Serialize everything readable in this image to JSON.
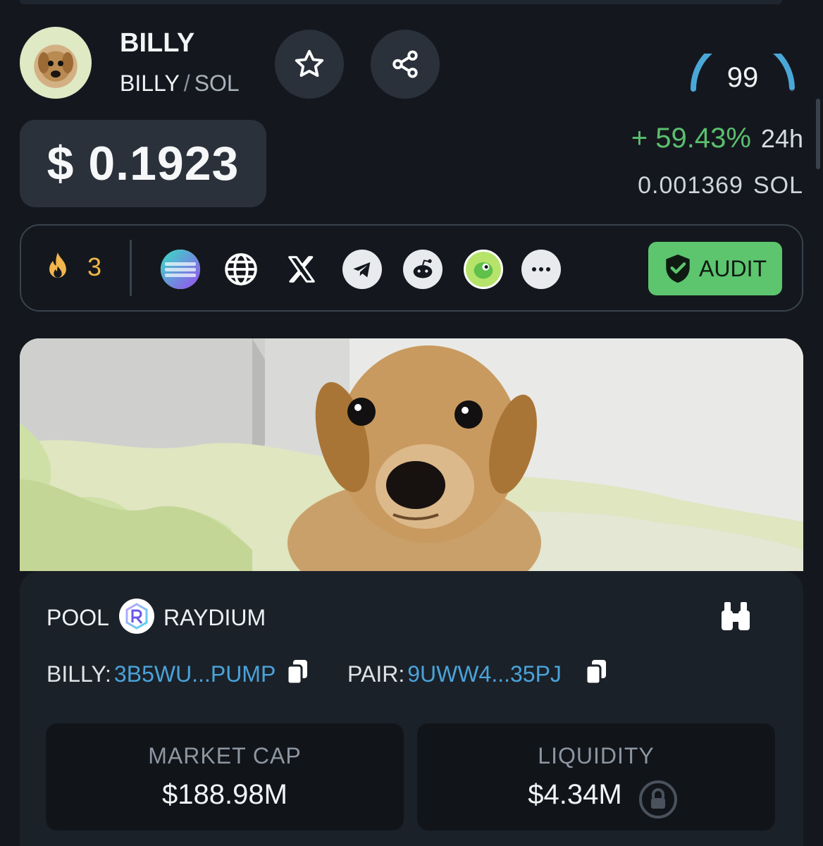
{
  "token": {
    "name": "BILLY",
    "base_symbol": "BILLY",
    "separator": "/",
    "quote_symbol": "SOL",
    "avatar_icon": "puppy-avatar"
  },
  "actions": {
    "favorite_icon": "star-icon",
    "share_icon": "share-icon"
  },
  "score": {
    "value": "99",
    "fraction": 0.99,
    "color": "#4aa8d8"
  },
  "price": {
    "usd": "$ 0.1923",
    "change": "+ 59.43%",
    "change_period": "24h",
    "sol_value": "0.001369",
    "sol_unit": "SOL"
  },
  "links_bar": {
    "trending_count": "3",
    "icons": [
      "solana-icon",
      "globe-icon",
      "x-icon",
      "telegram-icon",
      "reddit-icon",
      "coingecko-icon",
      "more-icon"
    ],
    "audit_label": "AUDIT"
  },
  "banner": {
    "image": "puppy-on-bed-banner"
  },
  "pool": {
    "label": "POOL",
    "dex": "RAYDIUM",
    "token_label": "BILLY:",
    "token_address": "3B5WU...PUMP",
    "pair_label": "PAIR:",
    "pair_address": "9UWW4...35PJ",
    "market_cap_label": "MARKET CAP",
    "market_cap_value": "$188.98M",
    "liquidity_label": "LIQUIDITY",
    "liquidity_value": "$4.34M"
  },
  "colors": {
    "background": "#14181e",
    "positive": "#5bbf6e",
    "link": "#4aa3d9",
    "audit": "#5cc56e",
    "trend": "#f0b84a"
  }
}
